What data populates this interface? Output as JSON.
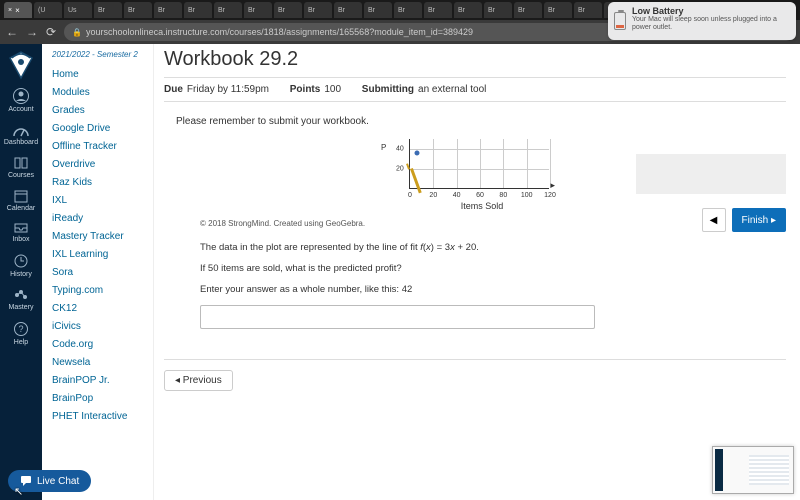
{
  "browser": {
    "tabs": [
      "×",
      "(U",
      "Us",
      "Br",
      "Br",
      "Br",
      "Br",
      "Br",
      "Br",
      "Br",
      "Br",
      "Br",
      "Br",
      "Br",
      "Br",
      "Br",
      "Br",
      "Br",
      "Br",
      "Br",
      "Br"
    ],
    "active_tab_index": 0,
    "url": "yourschoolonlineca.instructure.com/courses/1818/assignments/165568?module_item_id=389429"
  },
  "notification": {
    "title": "Low Battery",
    "detail": "Your Mac will sleep soon unless plugged into a power outlet."
  },
  "global_nav": {
    "items": [
      "Account",
      "Dashboard",
      "Courses",
      "Calendar",
      "Inbox",
      "History",
      "Mastery",
      "Help"
    ]
  },
  "course_nav": {
    "term": "2021/2022 - Semester 2",
    "items": [
      "Home",
      "Modules",
      "Grades",
      "Google Drive",
      "Offline Tracker",
      "Overdrive",
      "Raz Kids",
      "IXL",
      "iReady",
      "Mastery Tracker",
      "IXL Learning",
      "Sora",
      "Typing.com",
      "CK12",
      "iCivics",
      "Code.org",
      "Newsela",
      "BrainPOP Jr.",
      "BrainPop",
      "PHET Interactive"
    ]
  },
  "assignment": {
    "title": "Workbook 29.2",
    "due_label": "Due",
    "due_value": "Friday by 11:59pm",
    "points_label": "Points",
    "points_value": "100",
    "submitting_label": "Submitting",
    "submitting_value": "an external tool",
    "reminder": "Please remember to submit your workbook.",
    "copyright": "© 2018 StrongMind. Created using GeoGebra.",
    "line1": "The data in the plot are represented by the line of fit f(x) = 3x + 20.",
    "line2": "If 50 items are sold, what is the predicted profit?",
    "line3": "Enter your answer as a whole number, like this: 42",
    "y_label": "P",
    "x_axis_title": "Items Sold"
  },
  "chart_data": {
    "type": "scatter",
    "title": "",
    "xlabel": "Items Sold",
    "ylabel": "P",
    "xlim": [
      0,
      120
    ],
    "ylim": [
      0,
      50
    ],
    "xticks": [
      0,
      20,
      40,
      60,
      80,
      100,
      120
    ],
    "yticks": [
      20,
      40
    ],
    "points": [
      {
        "x": 6,
        "y": 35
      }
    ],
    "fit_line": {
      "slope": 3,
      "intercept": 20,
      "formula": "f(x) = 3x + 20"
    }
  },
  "buttons": {
    "finish": "Finish ▸",
    "prev_page": "◀",
    "previous": "◂ Previous"
  },
  "livechat": {
    "label": "Live Chat"
  }
}
